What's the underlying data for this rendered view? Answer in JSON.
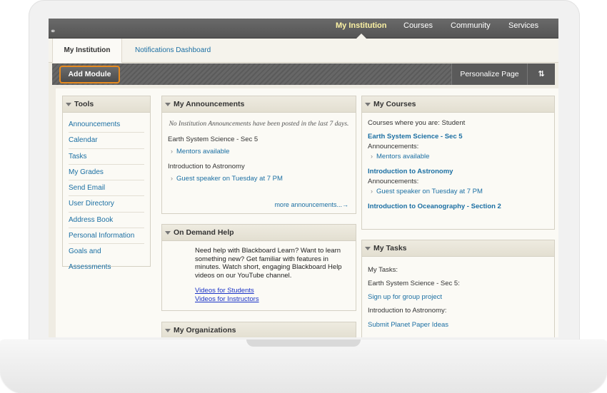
{
  "topnav": {
    "tabs": [
      {
        "label": "My Institution",
        "active": true
      },
      {
        "label": "Courses",
        "active": false
      },
      {
        "label": "Community",
        "active": false
      },
      {
        "label": "Services",
        "active": false
      }
    ]
  },
  "subtabs": {
    "active": "My Institution",
    "other": "Notifications Dashboard"
  },
  "actionbar": {
    "add_module": "Add Module",
    "personalize": "Personalize Page",
    "reorder_icon": "⇅"
  },
  "tools": {
    "title": "Tools",
    "items": [
      "Announcements",
      "Calendar",
      "Tasks",
      "My Grades",
      "Send Email",
      "User Directory",
      "Address Book",
      "Personal Information",
      "Goals and Assessments"
    ]
  },
  "announcements": {
    "title": "My Announcements",
    "none_message": "No Institution Announcements have been posted in the last 7 days.",
    "courses": [
      {
        "name": "Earth System Science - Sec 5",
        "item": "Mentors available"
      },
      {
        "name": "Introduction to Astronomy",
        "item": "Guest speaker on Tuesday at 7 PM"
      }
    ],
    "more": "more announcements...→"
  },
  "help": {
    "title": "On Demand Help",
    "text": "Need help with Blackboard Learn? Want to learn something new? Get familiar with features in minutes. Watch short, engaging Blackboard Help videos on our YouTube channel.",
    "link_students": "Videos for Students",
    "link_instructors": "Videos for Instructors"
  },
  "organizations": {
    "title": "My Organizations"
  },
  "courses": {
    "title": "My Courses",
    "role_label": "Courses where you are: Student",
    "course1": "Earth System Science - Sec 5",
    "ann_label1": "Announcements:",
    "item1": "Mentors available",
    "course2": "Introduction to Astronomy",
    "ann_label2": "Announcements:",
    "item2": "Guest speaker on Tuesday at 7 PM",
    "course3": "Introduction to Oceanography - Section 2"
  },
  "tasks": {
    "title": "My Tasks",
    "label": "My Tasks:",
    "course1": "Earth System Science - Sec 5:",
    "task1": "Sign up for group project",
    "course2": "Introduction to Astronomy:",
    "task2": "Submit Planet Paper Ideas"
  },
  "icons": {
    "link": "🔗",
    "chevron": "›"
  }
}
